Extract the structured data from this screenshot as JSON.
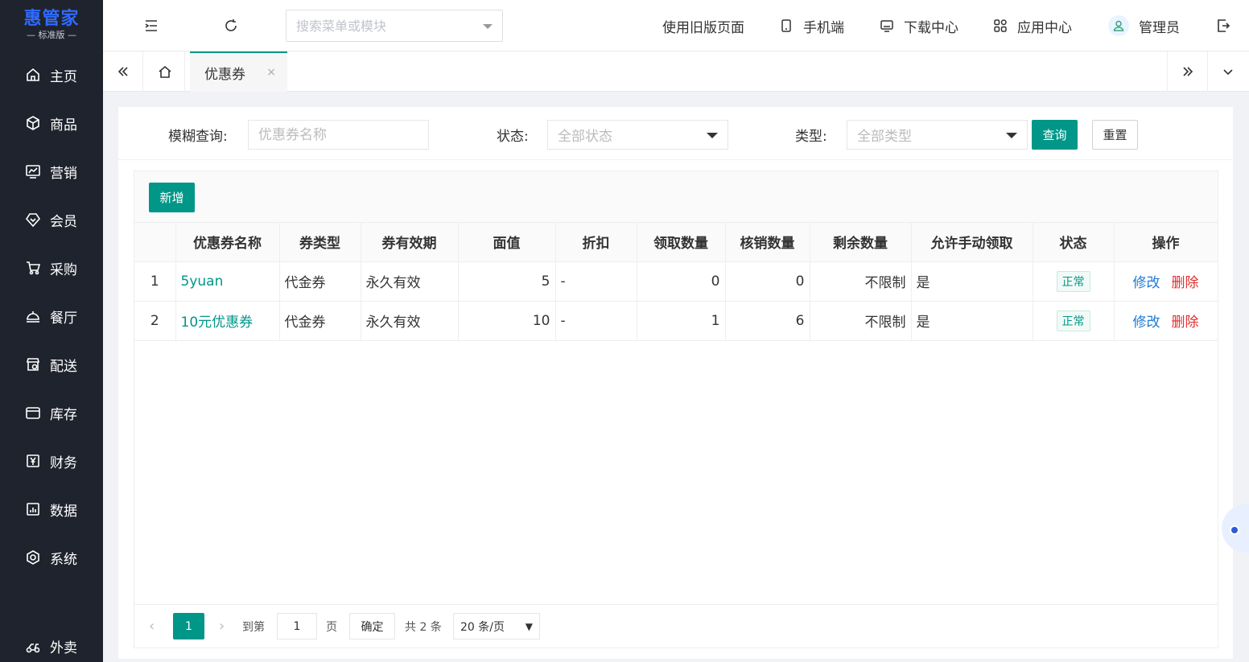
{
  "app": {
    "logo_main": "惠管家",
    "logo_sub": "— 标准版 —"
  },
  "sidebar": {
    "items": [
      {
        "label": "主页",
        "icon": "home-icon"
      },
      {
        "label": "商品",
        "icon": "box-icon"
      },
      {
        "label": "营销",
        "icon": "chart-icon"
      },
      {
        "label": "会员",
        "icon": "diamond-icon"
      },
      {
        "label": "采购",
        "icon": "cart-icon"
      },
      {
        "label": "餐厅",
        "icon": "dish-icon"
      },
      {
        "label": "配送",
        "icon": "store-icon"
      },
      {
        "label": "库存",
        "icon": "inventory-icon"
      },
      {
        "label": "财务",
        "icon": "yen-icon"
      },
      {
        "label": "数据",
        "icon": "bar-chart-icon"
      },
      {
        "label": "系统",
        "icon": "settings-icon"
      },
      {
        "label": "外卖",
        "icon": "scooter-icon"
      }
    ]
  },
  "header": {
    "search_placeholder": "搜索菜单或模块",
    "old_version": "使用旧版页面",
    "mobile": "手机端",
    "download": "下载中心",
    "apps": "应用中心",
    "user": "管理员"
  },
  "tabs": {
    "active": "优惠券",
    "close": "×"
  },
  "filters": {
    "keyword_label": "模糊查询:",
    "keyword_placeholder": "优惠券名称",
    "status_label": "状态:",
    "status_value": "全部状态",
    "type_label": "类型:",
    "type_value": "全部类型",
    "query_button": "查询",
    "reset_button": "重置"
  },
  "toolbar": {
    "add_button": "新增"
  },
  "table": {
    "columns": [
      "",
      "优惠券名称",
      "券类型",
      "券有效期",
      "面值",
      "折扣",
      "领取数量",
      "核销数量",
      "剩余数量",
      "允许手动领取",
      "状态",
      "操作"
    ],
    "rows": [
      {
        "index": "1",
        "name": "5yuan",
        "type": "代金券",
        "validity": "永久有效",
        "face_value": "5",
        "discount": "-",
        "claimed": "0",
        "redeemed": "0",
        "remaining": "不限制",
        "manual_claim": "是",
        "status": "正常",
        "edit": "修改",
        "delete": "删除"
      },
      {
        "index": "2",
        "name": "10元优惠券",
        "type": "代金券",
        "validity": "永久有效",
        "face_value": "10",
        "discount": "-",
        "claimed": "1",
        "redeemed": "6",
        "remaining": "不限制",
        "manual_claim": "是",
        "status": "正常",
        "edit": "修改",
        "delete": "删除"
      }
    ]
  },
  "pager": {
    "prev": "‹",
    "current": "1",
    "next": "›",
    "goto_label": "到第",
    "goto_value": "1",
    "page_unit": "页",
    "confirm": "确定",
    "total": "共 2 条",
    "page_size": "20 条/页"
  },
  "colors": {
    "primary": "#009688",
    "sidebar_bg": "#1f232d",
    "logo": "#2f6bff",
    "link_blue": "#1e7ad8",
    "danger": "#e0302f"
  }
}
